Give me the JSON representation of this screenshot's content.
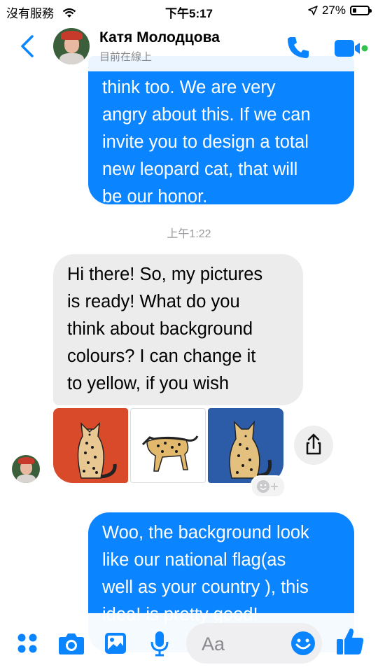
{
  "status_bar": {
    "carrier": "沒有服務",
    "time": "下午5:17",
    "battery_text": "27%",
    "battery_level": 0.27
  },
  "header": {
    "contact_name": "Катя Молодцова",
    "presence": "目前在線上"
  },
  "messages": {
    "outgoing_1_lines": [
      "think too. We are very",
      "angry about this. If we can",
      "invite you to design a total",
      "new leopard cat, that will",
      "be our honor."
    ],
    "timestamp": "上午1:22",
    "incoming_1_lines": [
      "Hi there! So, my pictures",
      "is ready! What do you",
      "think about background",
      "colours? I can change it",
      "to yellow, if you wish"
    ],
    "attachments": [
      {
        "background": "#d84a2a",
        "subject": "seated leopard cat"
      },
      {
        "background": "#ffffff",
        "subject": "walking leopard cat"
      },
      {
        "background": "#2c5ba8",
        "subject": "seated leopard cat"
      }
    ],
    "outgoing_2_lines": [
      "Woo, the background look",
      "like our national flag(as",
      "well as your country ), this",
      "idea! is pretty good!"
    ]
  },
  "composer": {
    "placeholder": "Aa"
  },
  "colors": {
    "accent": "#0a84ff",
    "incoming_bubble": "#ececec",
    "online_dot": "#31c24d"
  }
}
